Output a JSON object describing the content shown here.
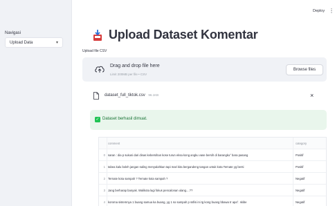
{
  "sidebar": {
    "nav_label": "Navigasi",
    "nav_selected": "Upload Data"
  },
  "header": {
    "deploy": "Deploy",
    "menu_glyph": "⋮"
  },
  "main": {
    "title": "Upload Dataset Komentar",
    "upload_label": "Upload file CSV",
    "dropzone": {
      "title": "Drag and drop file here",
      "subtitle": "Limit 200MB per file • CSV",
      "browse": "Browse files"
    },
    "file": {
      "name": "dataset_full_tiktok.csv",
      "size": "96.1KB",
      "close": "×"
    },
    "alert": {
      "text": "Dataset berhasil dimuat.",
      "check": "✓"
    },
    "table": {
      "columns": [
        "comment",
        "category"
      ],
      "rows": [
        {
          "idx": "0",
          "comment": "saran : dia p sukusi dari dinas kebersihan kose turun eksa kong angku vase bersih di barangku° bara pasang",
          "category": "Positif"
        },
        {
          "idx": "1",
          "comment": "tabea kalu boleh jangan saling menyalahkan tapi mari kita bergandeng tangan untuk kota Ternate yg bersi",
          "category": "Positif"
        },
        {
          "idx": "2",
          "comment": "Ternate kota sampah ? Ternate kota sampah ?",
          "category": "Negatif"
        },
        {
          "idx": "3",
          "comment": "Jang berharap banyak. Walikota lagi fokus pencalonan ulang....??",
          "category": "Negatif"
        },
        {
          "idx": "4",
          "comment": "koroma sistemnya 1 buang samua ka buang, yg 1 so sampah p ssfisi ini tg kong buang bbawa tr apa°. skibe",
          "category": "Negatif"
        }
      ]
    }
  },
  "colors": {
    "sidebar_bg": "#f0f2f6",
    "alert_bg": "#e9f6ec",
    "alert_text": "#177233",
    "success": "#21c354"
  }
}
